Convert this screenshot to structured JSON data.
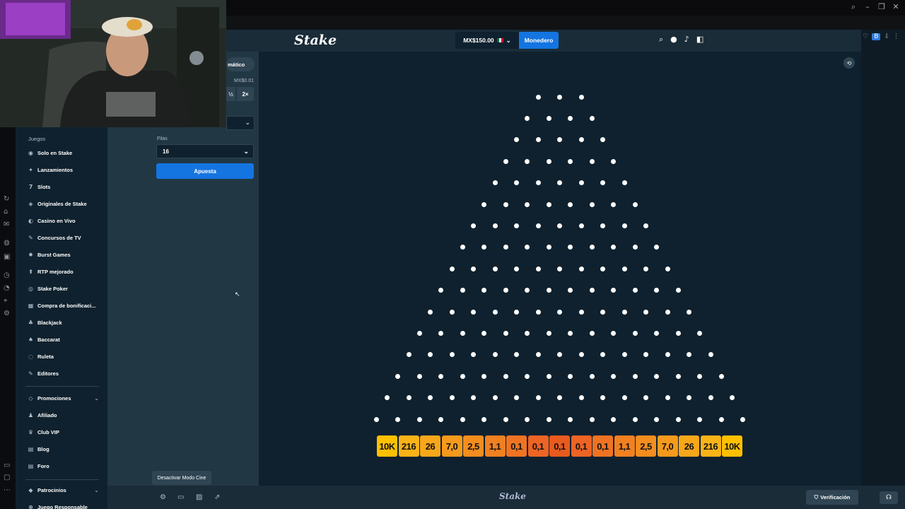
{
  "browser": {
    "window_icons": [
      "search-icon",
      "minimize-icon",
      "restore-icon",
      "close-icon"
    ],
    "extension_badge": "B"
  },
  "header": {
    "logo": "Stake",
    "balance": "MX$150.00",
    "wallet_label": "Monedero"
  },
  "bet_panel": {
    "tab_auto_label": "mático",
    "min_bet": "MX$0.01",
    "half_label": "½",
    "double_label": "2×",
    "rows_label": "Filas",
    "rows_value": "16",
    "bet_button": "Apuesta"
  },
  "sidebar": {
    "section_games": "Juegos",
    "items": [
      {
        "label": "Solo en Stake",
        "icon": "stake-icon"
      },
      {
        "label": "Lanzamientos",
        "icon": "sparkle-icon"
      },
      {
        "label": "Slots",
        "icon": "slots-icon"
      },
      {
        "label": "Originales de Stake",
        "icon": "originals-icon"
      },
      {
        "label": "Casino en Vivo",
        "icon": "live-casino-icon"
      },
      {
        "label": "Concursos de TV",
        "icon": "tv-icon"
      },
      {
        "label": "Burst Games",
        "icon": "burst-icon"
      },
      {
        "label": "RTP mejorado",
        "icon": "rtp-icon"
      },
      {
        "label": "Stake Poker",
        "icon": "poker-icon"
      },
      {
        "label": "Compra de bonificaci...",
        "icon": "bonus-icon"
      },
      {
        "label": "Blackjack",
        "icon": "blackjack-icon"
      },
      {
        "label": "Baccarat",
        "icon": "baccarat-icon"
      },
      {
        "label": "Ruleta",
        "icon": "roulette-icon"
      },
      {
        "label": "Editores",
        "icon": "editors-icon"
      }
    ],
    "items2": [
      {
        "label": "Promociones",
        "icon": "promo-icon"
      },
      {
        "label": "Afiliado",
        "icon": "affiliate-icon"
      },
      {
        "label": "Club VIP",
        "icon": "trophy-icon"
      },
      {
        "label": "Blog",
        "icon": "blog-icon"
      },
      {
        "label": "Foro",
        "icon": "forum-icon"
      }
    ],
    "items3": [
      {
        "label": "Patrocinios",
        "icon": "sponsor-icon"
      },
      {
        "label": "Juego Responsable",
        "icon": "responsible-icon"
      }
    ]
  },
  "plinko": {
    "rows": 16,
    "multipliers": [
      "10K",
      "216",
      "26",
      "7,0",
      "2,5",
      "1,1",
      "0,1",
      "0,1",
      "0,1",
      "0,1",
      "0,1",
      "1,1",
      "2,5",
      "7,0",
      "26",
      "216",
      "10K"
    ],
    "colors": [
      "#ffc000",
      "#f9b318",
      "#f7a71a",
      "#f59a1c",
      "#f38d1e",
      "#f18020",
      "#ef7322",
      "#ed6424",
      "#e85a1f",
      "#ed6424",
      "#ef7322",
      "#f18020",
      "#f38d1e",
      "#f59a1c",
      "#f7a71a",
      "#f9b318",
      "#ffc000"
    ]
  },
  "footer": {
    "tooltip": "Desactivar Modo Cine",
    "logo": "Stake",
    "verification": "Verificación"
  }
}
